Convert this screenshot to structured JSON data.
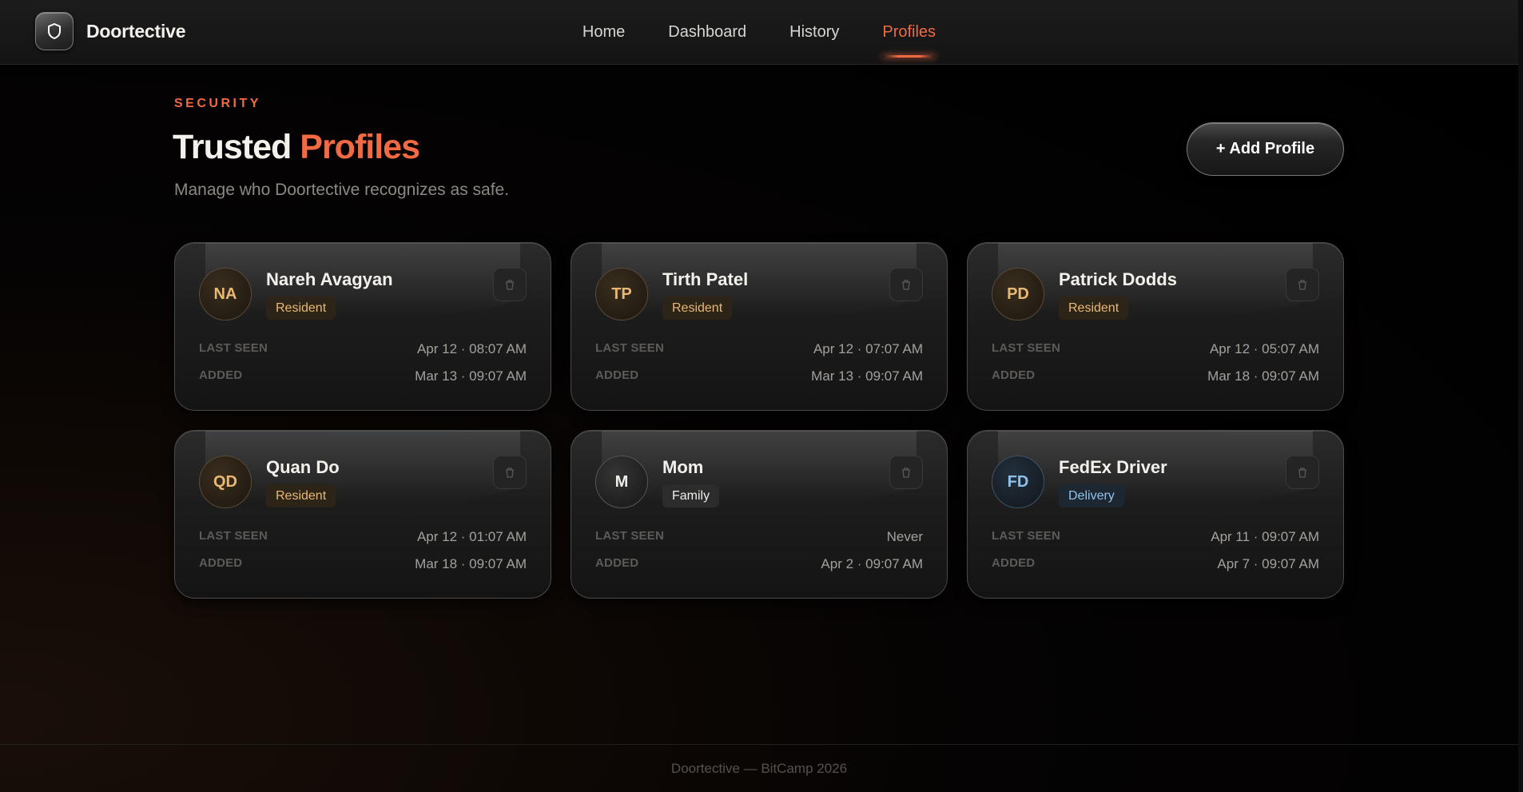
{
  "nav": {
    "brand": "Doortective",
    "links": [
      {
        "label": "Home",
        "active": false
      },
      {
        "label": "Dashboard",
        "active": false
      },
      {
        "label": "History",
        "active": false
      },
      {
        "label": "Profiles",
        "active": true
      }
    ]
  },
  "header": {
    "eyebrow": "SECURITY",
    "title_main": "Trusted",
    "title_accent": "Profiles",
    "subtitle": "Manage who Doortective recognizes as safe.",
    "add_button": "+ Add Profile"
  },
  "labels": {
    "last_seen": "LAST SEEN",
    "added": "ADDED"
  },
  "profiles": [
    {
      "initials": "NA",
      "name": "Nareh Avagyan",
      "tag": "Resident",
      "last_seen": "Apr 12 · 08:07 AM",
      "added": "Mar 13 · 09:07 AM"
    },
    {
      "initials": "TP",
      "name": "Tirth Patel",
      "tag": "Resident",
      "last_seen": "Apr 12 · 07:07 AM",
      "added": "Mar 13 · 09:07 AM"
    },
    {
      "initials": "PD",
      "name": "Patrick Dodds",
      "tag": "Resident",
      "last_seen": "Apr 12 · 05:07 AM",
      "added": "Mar 18 · 09:07 AM"
    },
    {
      "initials": "QD",
      "name": "Quan Do",
      "tag": "Resident",
      "last_seen": "Apr 12 · 01:07 AM",
      "added": "Mar 18 · 09:07 AM"
    },
    {
      "initials": "M",
      "name": "Mom",
      "tag": "Family",
      "last_seen": "Never",
      "added": "Apr 2 · 09:07 AM"
    },
    {
      "initials": "FD",
      "name": "FedEx Driver",
      "tag": "Delivery",
      "last_seen": "Apr 11 · 09:07 AM",
      "added": "Apr 7 · 09:07 AM"
    }
  ],
  "colors": {
    "accent": "#f06a43",
    "resident_tag": "#e9b872",
    "delivery_tag": "#8fc3f0"
  },
  "footer": "Doortective — BitCamp 2026"
}
